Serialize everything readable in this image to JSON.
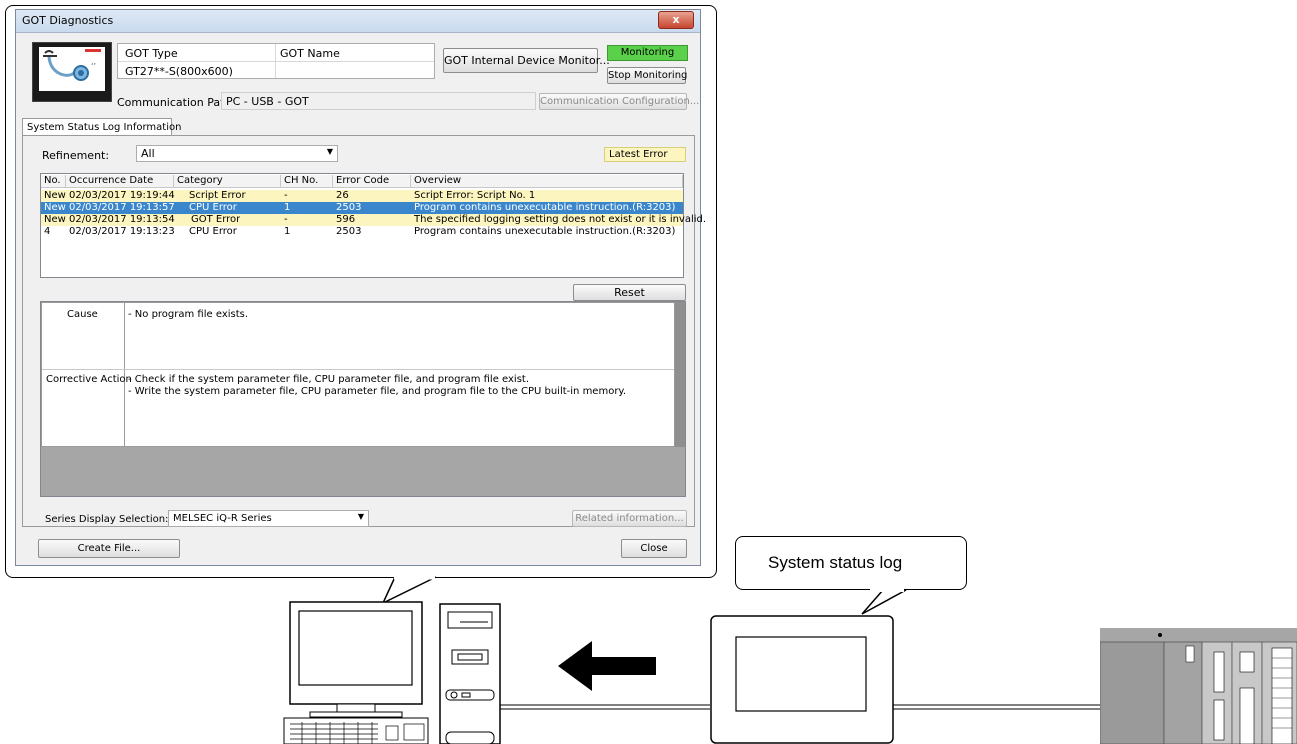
{
  "window": {
    "title": "GOT Diagnostics",
    "close_glyph": "x"
  },
  "header": {
    "got_type_label": "GOT Type",
    "got_name_label": "GOT Name",
    "got_type_value": "GT27**-S(800x600)",
    "got_name_value": "",
    "internal_monitor_button": "GOT Internal Device Monitor...",
    "monitoring_badge": "Monitoring",
    "stop_monitoring_button": "Stop Monitoring",
    "comm_path_label": "Communication Path:",
    "comm_path_value": "PC - USB - GOT",
    "comm_config_button": "Communication Configuration..."
  },
  "tabs": [
    {
      "label": "System Status Log Information",
      "active": true
    }
  ],
  "refinement": {
    "label": "Refinement:",
    "value": "All",
    "latest_error_badge": "Latest Error"
  },
  "table": {
    "columns": [
      "No.",
      "Occurrence Date",
      "Category",
      "CH No.",
      "Error Code",
      "Overview"
    ],
    "rows": [
      {
        "no": "New",
        "date": "02/03/2017 19:19:44",
        "category": "Script Error",
        "category_icon": "script-icon",
        "ch": "-",
        "code": "26",
        "overview": "Script Error: Script No. 1",
        "state": "new"
      },
      {
        "no": "New",
        "date": "02/03/2017 19:13:57",
        "category": "CPU Error",
        "category_icon": "cpu-icon",
        "ch": "1",
        "code": "2503",
        "overview": "Program contains unexecutable instruction.(R:3203)",
        "state": "selected"
      },
      {
        "no": "New",
        "date": "02/03/2017 19:13:54",
        "category": "GOT Error",
        "category_icon": "got-icon",
        "ch": "-",
        "code": "596",
        "overview": "The specified logging setting does not exist or it is invalid.",
        "state": "new"
      },
      {
        "no": "4",
        "date": "02/03/2017 19:13:23",
        "category": "CPU Error",
        "category_icon": "cpu-icon",
        "ch": "1",
        "code": "2503",
        "overview": "Program contains unexecutable instruction.(R:3203)",
        "state": "normal"
      }
    ],
    "reset_button": "Reset"
  },
  "details": {
    "cause_label": "Cause",
    "cause_text": "- No program file exists.",
    "action_label": "Corrective Action",
    "action_line1": "- Check if the system parameter file, CPU parameter file, and program file exist.",
    "action_line2": "- Write the system parameter file, CPU parameter file, and program file to the CPU built-in memory."
  },
  "footer": {
    "series_label": "Series Display Selection:",
    "series_value": "MELSEC iQ-R Series",
    "related_button": "Related information...",
    "create_file_button": "Create File...",
    "close_button": "Close"
  },
  "illustration": {
    "bubble_text": "System status log"
  },
  "colors": {
    "new_row": "#fdf5c0",
    "selected_row": "#3a86cc",
    "monitoring_badge": "#5bd04a",
    "latest_error_badge": "#fdf5c0"
  }
}
